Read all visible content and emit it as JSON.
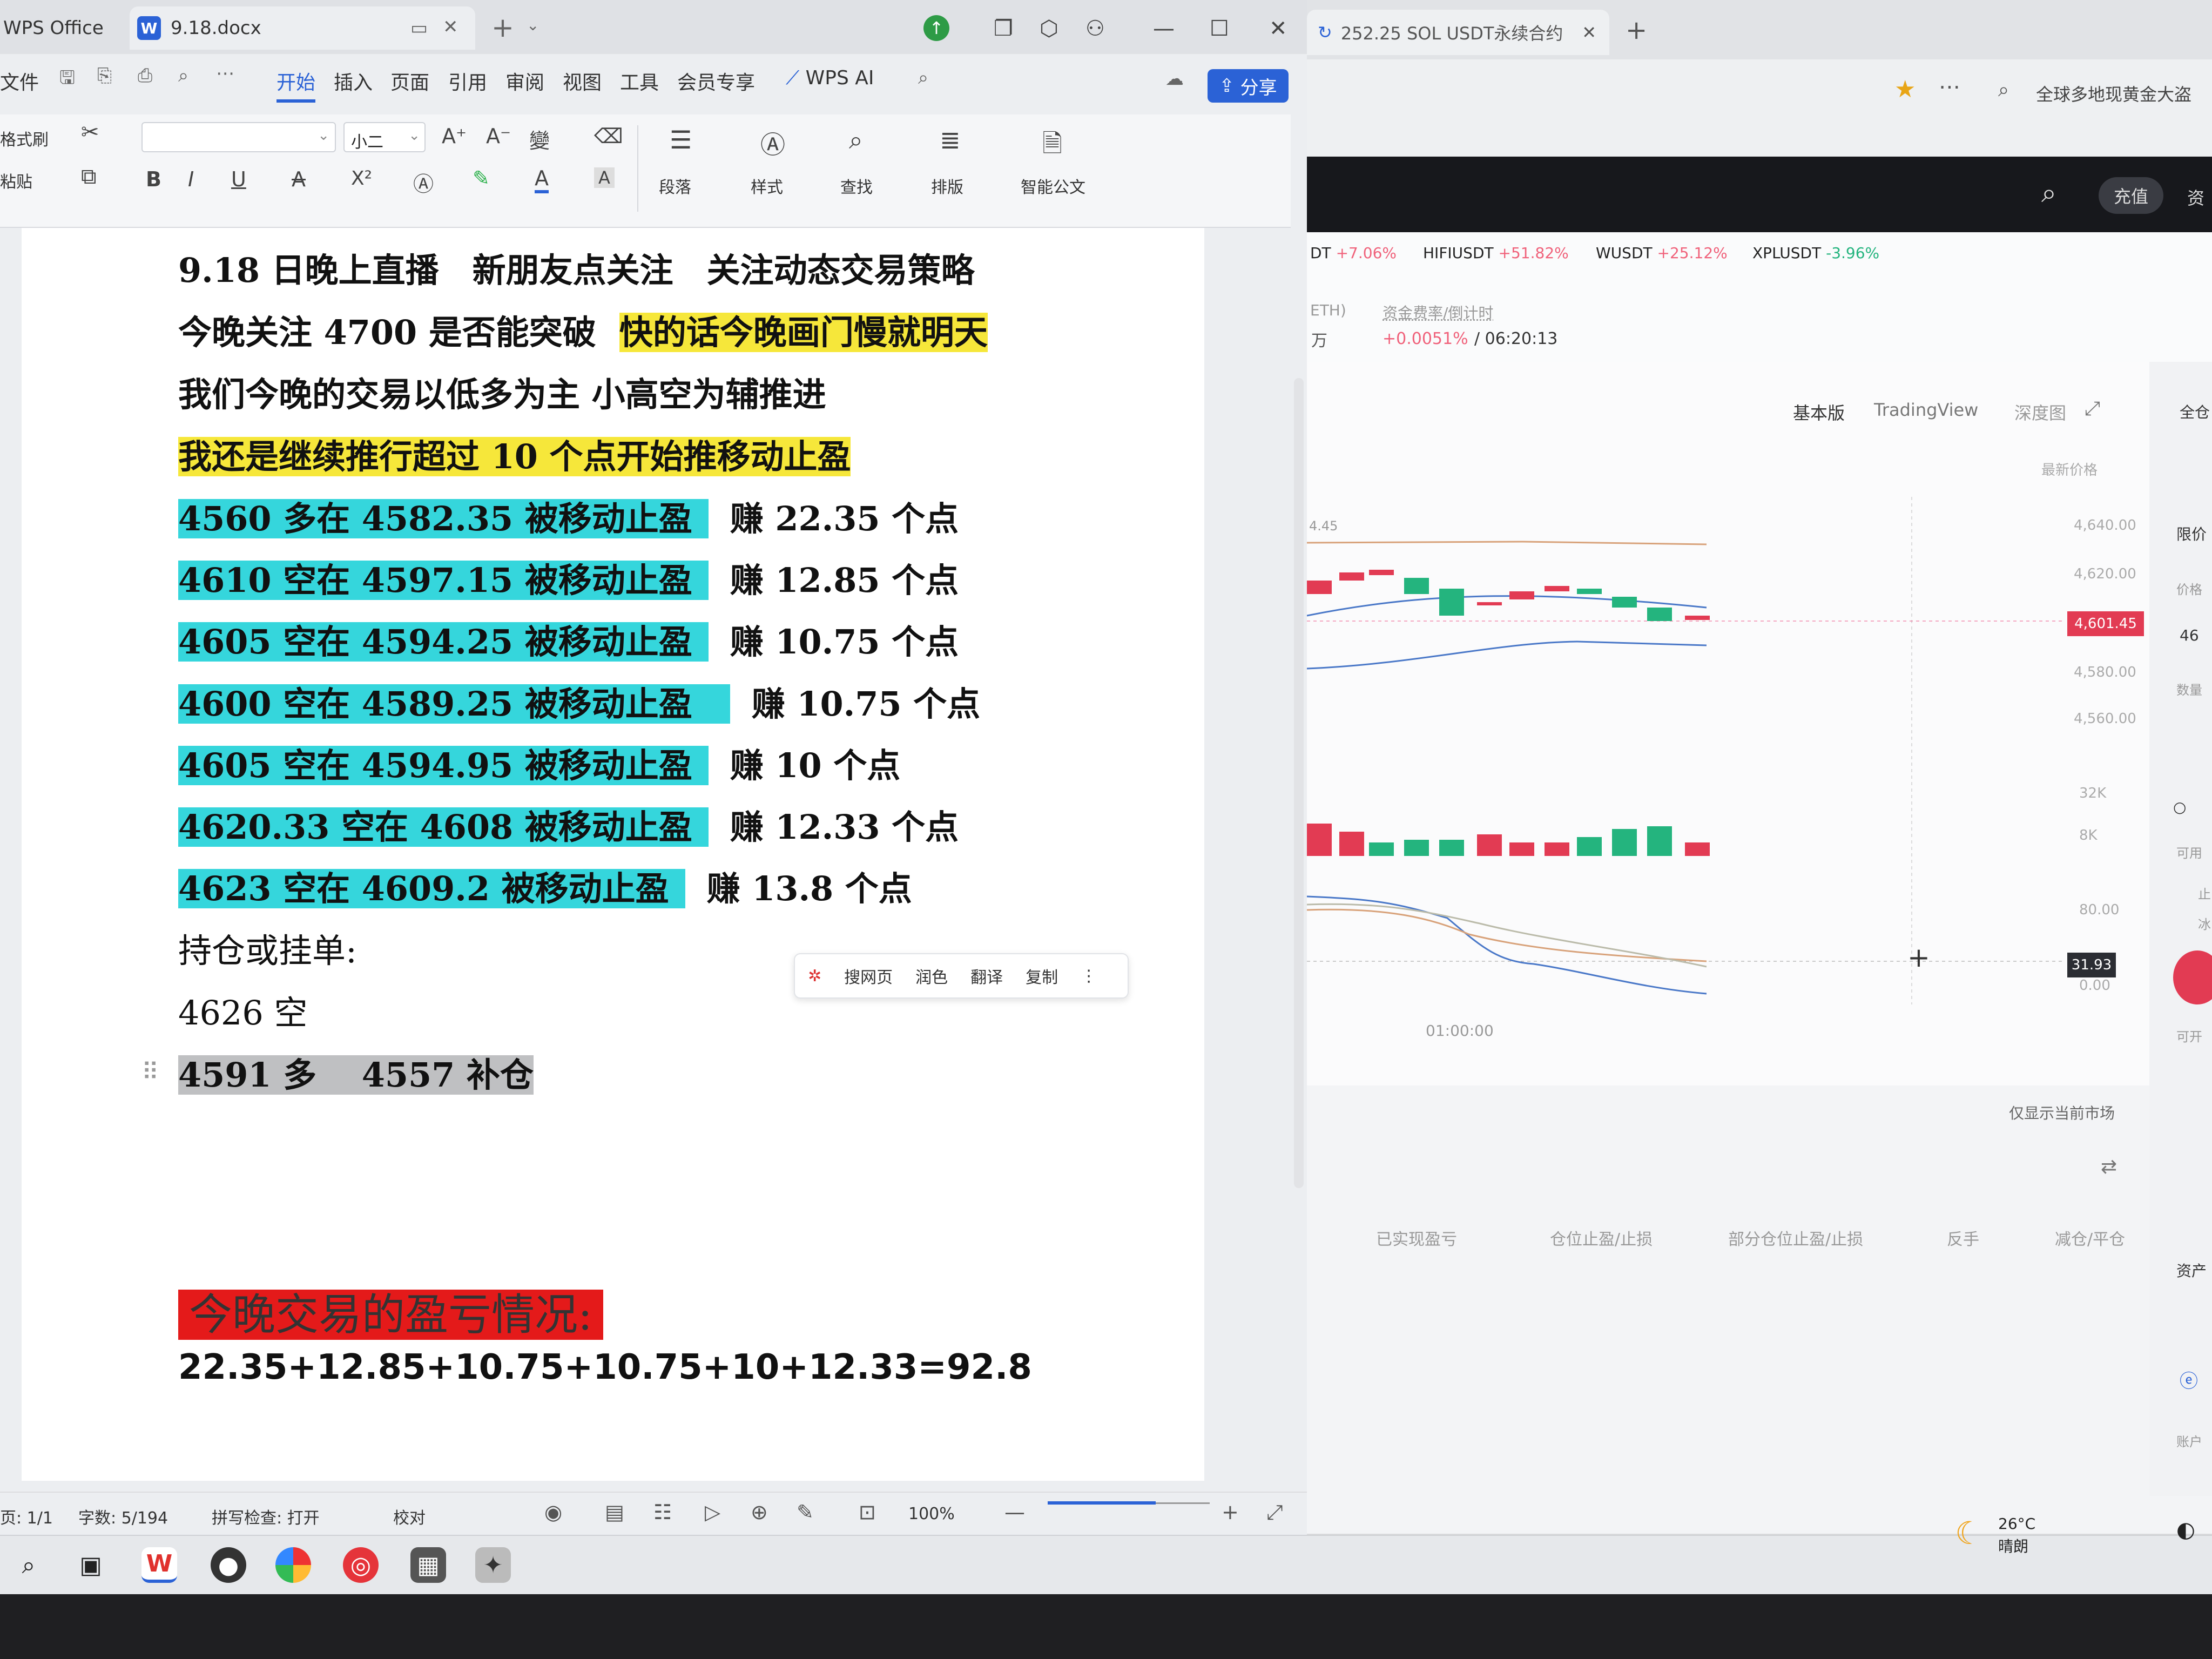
{
  "wps": {
    "home_tab": "WPS Office",
    "doc_tab": "9.18.docx",
    "menu": [
      "文件",
      "开始",
      "插入",
      "页面",
      "引用",
      "审阅",
      "视图",
      "工具",
      "会员专享",
      "WPS AI"
    ],
    "share_label": "分享",
    "ribbon": {
      "format_painter": "格式刷",
      "paste": "粘贴",
      "font_size": "小二",
      "paragraph": "段落",
      "styles": "样式",
      "find": "查找",
      "layout": "排版",
      "smart_doc": "智能公文"
    },
    "document": {
      "lines": [
        "9.18 日晚上直播　新朋友点关注　关注动态交易策略",
        "今晚关注 4700 是否能突破",
        "快的话今晚画门慢就明天",
        "我们今晚的交易以低多为主  小高空为辅推进",
        "我还是继续推行超过 10 个点开始推移动止盈"
      ],
      "trades": [
        {
          "entry": "4560 多在 4582.35 被移动止盈",
          "profit": "赚 22.35 个点"
        },
        {
          "entry": "4610 空在 4597.15 被移动止盈",
          "profit": "赚 12.85 个点"
        },
        {
          "entry": "4605 空在 4594.25 被移动止盈",
          "profit": "赚 10.75 个点"
        },
        {
          "entry": "4600 空在 4589.25 被移动止盈",
          "profit": "赚 10.75 个点"
        },
        {
          "entry": "4605 空在 4594.95 被移动止盈",
          "profit": "赚 10 个点"
        },
        {
          "entry": "4620.33 空在 4608 被移动止盈",
          "profit": "赚 12.33 个点"
        },
        {
          "entry": "4623 空在 4609.2 被移动止盈",
          "profit": "赚 13.8 个点"
        }
      ],
      "positions_title": "持仓或挂单:",
      "position_1": "4626 空",
      "position_2": "4591 多　 4557 补仓",
      "pnl_title": "今晚交易的盈亏情况:",
      "pnl_sum": "22.35+12.85+10.75+10.75+10+12.33=92.8"
    },
    "float_toolbar": [
      "搜网页",
      "润色",
      "翻译",
      "复制"
    ],
    "status": {
      "page": "页: 1/1",
      "words": "字数: 5/194",
      "spell": "拼写检查: 打开",
      "proof": "校对",
      "zoom": "100%"
    }
  },
  "browser": {
    "tab_title": "252.25 SOL USDT永续合约",
    "search_text": "全球多地现黄金大盗",
    "recharge": "充值",
    "assets_partial": "资",
    "tickers": [
      {
        "sym": "DT",
        "chg": "+7.06%",
        "dir": "up"
      },
      {
        "sym": "HIFIUSDT",
        "chg": "+51.82%",
        "dir": "up"
      },
      {
        "sym": "WUSDT",
        "chg": "+25.12%",
        "dir": "up"
      },
      {
        "sym": "XPLUSDT",
        "chg": "-3.96%",
        "dir": "down"
      }
    ],
    "funding_label": "资金费率/倒计时",
    "funding_value": "+0.0051%",
    "funding_time": "/ 06:20:13",
    "eth_label": "ETH)",
    "wan": "万",
    "view_tabs": [
      "基本版",
      "TradingView",
      "深度图"
    ],
    "latest_price_label": "最新价格",
    "price_ticks": [
      "4,640.00",
      "4,620.00",
      "4,580.00",
      "4,560.00"
    ],
    "current_price": "4,601.45",
    "vol_ticks": [
      "32K",
      "8K"
    ],
    "osc_ticks": [
      "80.00",
      "0.00"
    ],
    "osc_value": "31.93",
    "chart_start_label": "4.45",
    "time_label": "01:00:00",
    "only_current": "仅显示当前市场",
    "bottom_tabs": [
      "已实现盈亏",
      "仓位止盈/止损",
      "部分仓位止盈/止损",
      "反手",
      "减仓/平仓"
    ],
    "side_labels": [
      "全仓",
      "限价",
      "价格",
      "46",
      "数量",
      "可用",
      "止",
      "冰",
      "可开",
      "资产",
      "账户"
    ]
  },
  "taskbar": {
    "weather_temp": "26°C",
    "weather_desc": "晴朗"
  },
  "colors": {
    "wps_blue": "#2b62d6",
    "highlight_cyan": "#35d6dc",
    "highlight_yellow": "#f6e73a",
    "highlight_red": "#e41a1a",
    "candle_up": "#24b47e",
    "candle_down": "#e23b53"
  }
}
